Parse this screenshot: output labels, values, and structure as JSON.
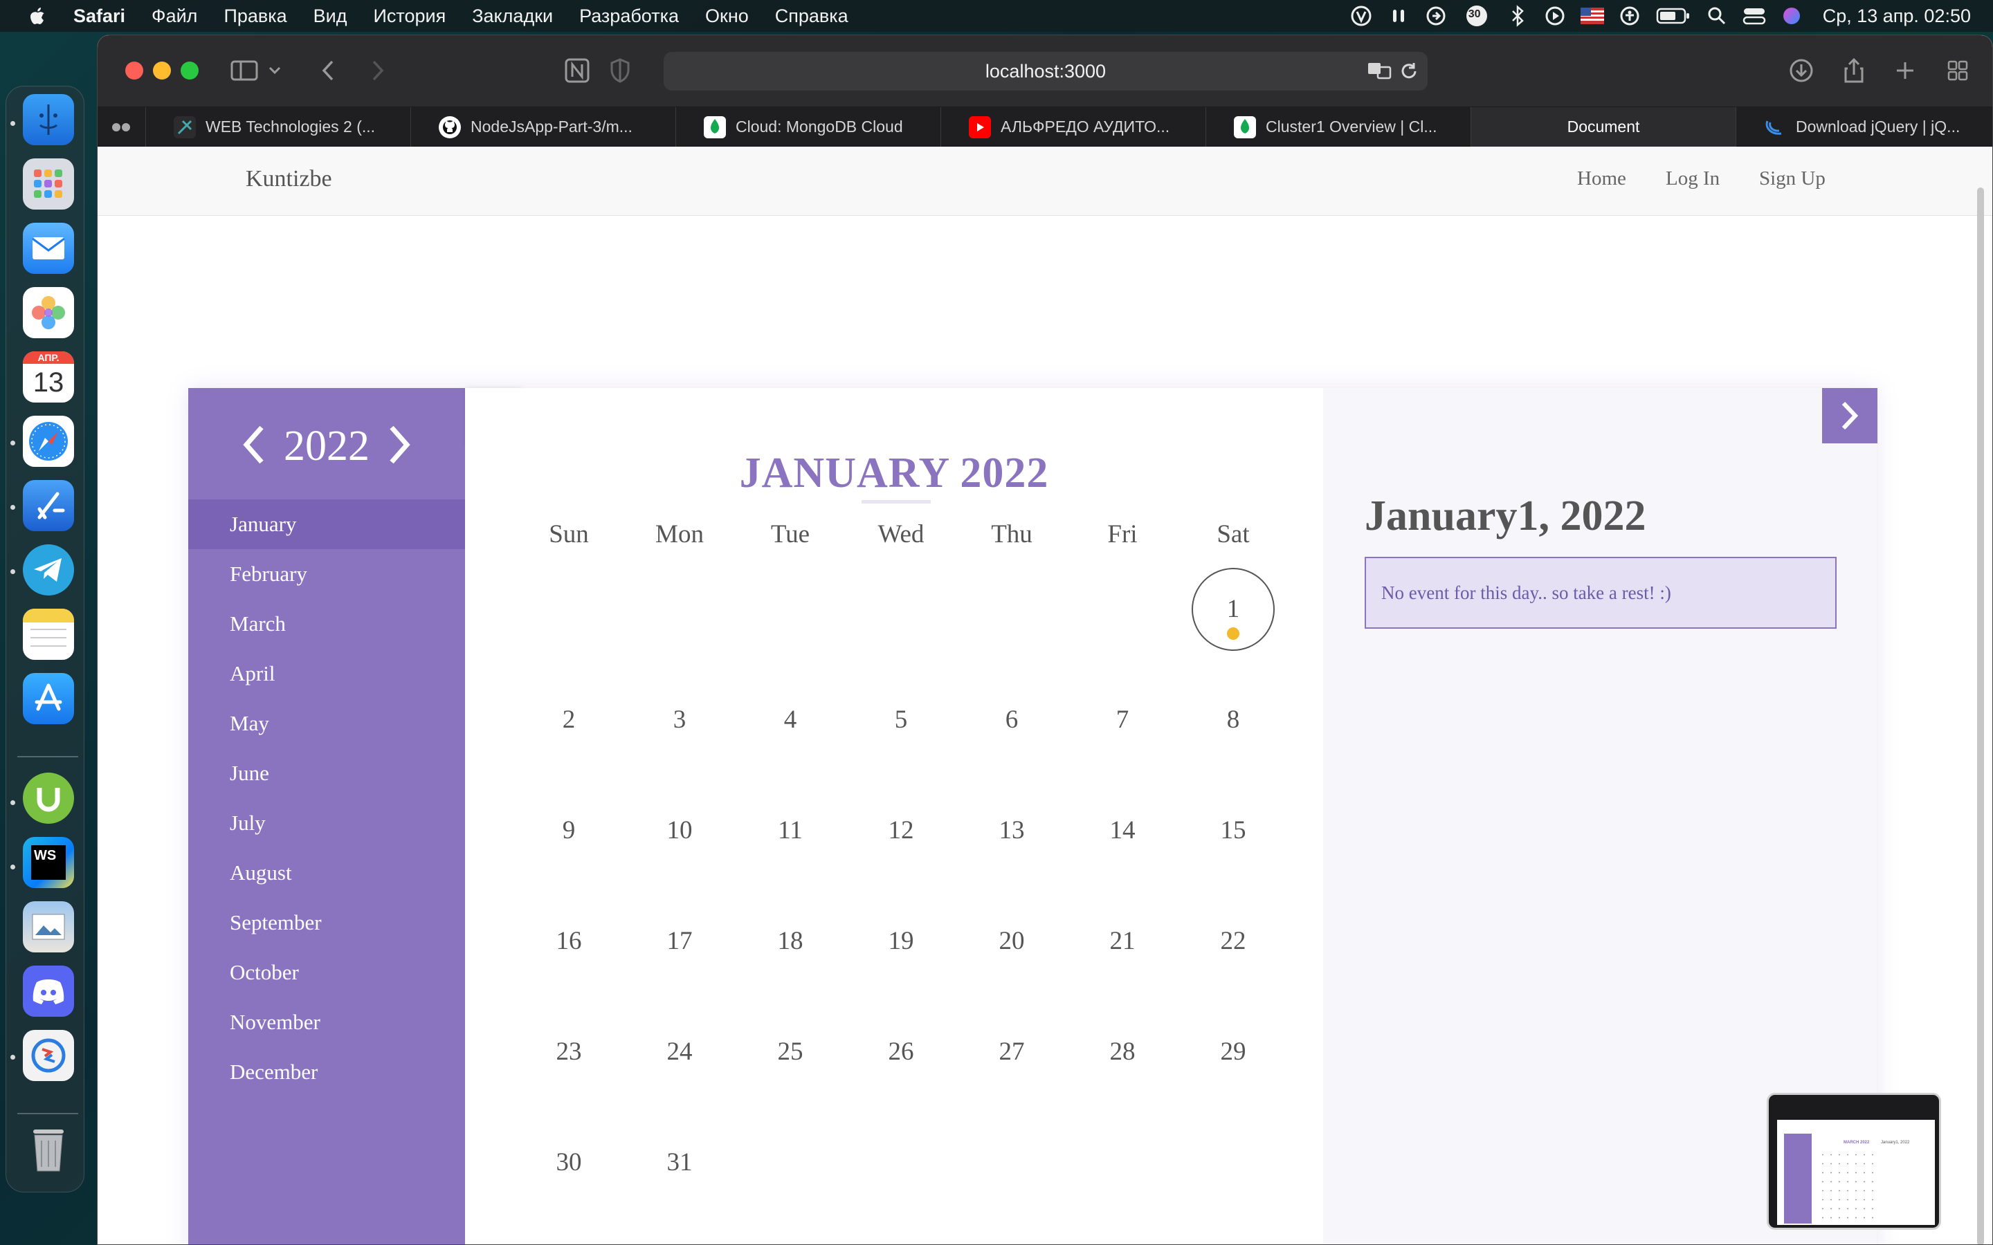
{
  "menubar": {
    "app_name": "Safari",
    "items": [
      "Файл",
      "Правка",
      "Вид",
      "История",
      "Закладки",
      "Разработка",
      "Окно",
      "Справка"
    ],
    "badge": "30",
    "clock": "Ср, 13 апр.  02:50"
  },
  "dock": {
    "calendar_month": "АПР.",
    "calendar_day": "13",
    "webstorm_label": "WS"
  },
  "browser": {
    "address": "localhost:3000",
    "tabs": [
      {
        "label": "WEB Technologies 2 (..."
      },
      {
        "label": "NodeJsApp-Part-3/m..."
      },
      {
        "label": "Cloud: MongoDB Cloud"
      },
      {
        "label": "АЛЬФРЕДО АУДИТО..."
      },
      {
        "label": "Cluster1 Overview | Cl..."
      },
      {
        "label": "Document"
      },
      {
        "label": "Download jQuery | jQ..."
      }
    ]
  },
  "site": {
    "brand": "Kuntizbe",
    "nav": {
      "home": "Home",
      "login": "Log In",
      "signup": "Sign Up"
    }
  },
  "calendar": {
    "year": "2022",
    "months": [
      "January",
      "February",
      "March",
      "April",
      "May",
      "June",
      "July",
      "August",
      "September",
      "October",
      "November",
      "December"
    ],
    "selected_month": "January",
    "title": "JANUARY 2022",
    "weekdays": [
      "Sun",
      "Mon",
      "Tue",
      "Wed",
      "Thu",
      "Fri",
      "Sat"
    ],
    "first_weekday_index": 6,
    "days_in_month": 31,
    "selected_day": 1,
    "detail_title": "January1, 2022",
    "event_text": "No event for this day.. so take a rest! :)"
  },
  "thumbnail": {
    "title": "MARCH 2022",
    "detail": "January1, 2022"
  },
  "colors": {
    "accent": "#8a74c0",
    "accent_dark": "#7a62b4",
    "event_dot": "#f1b92b"
  }
}
